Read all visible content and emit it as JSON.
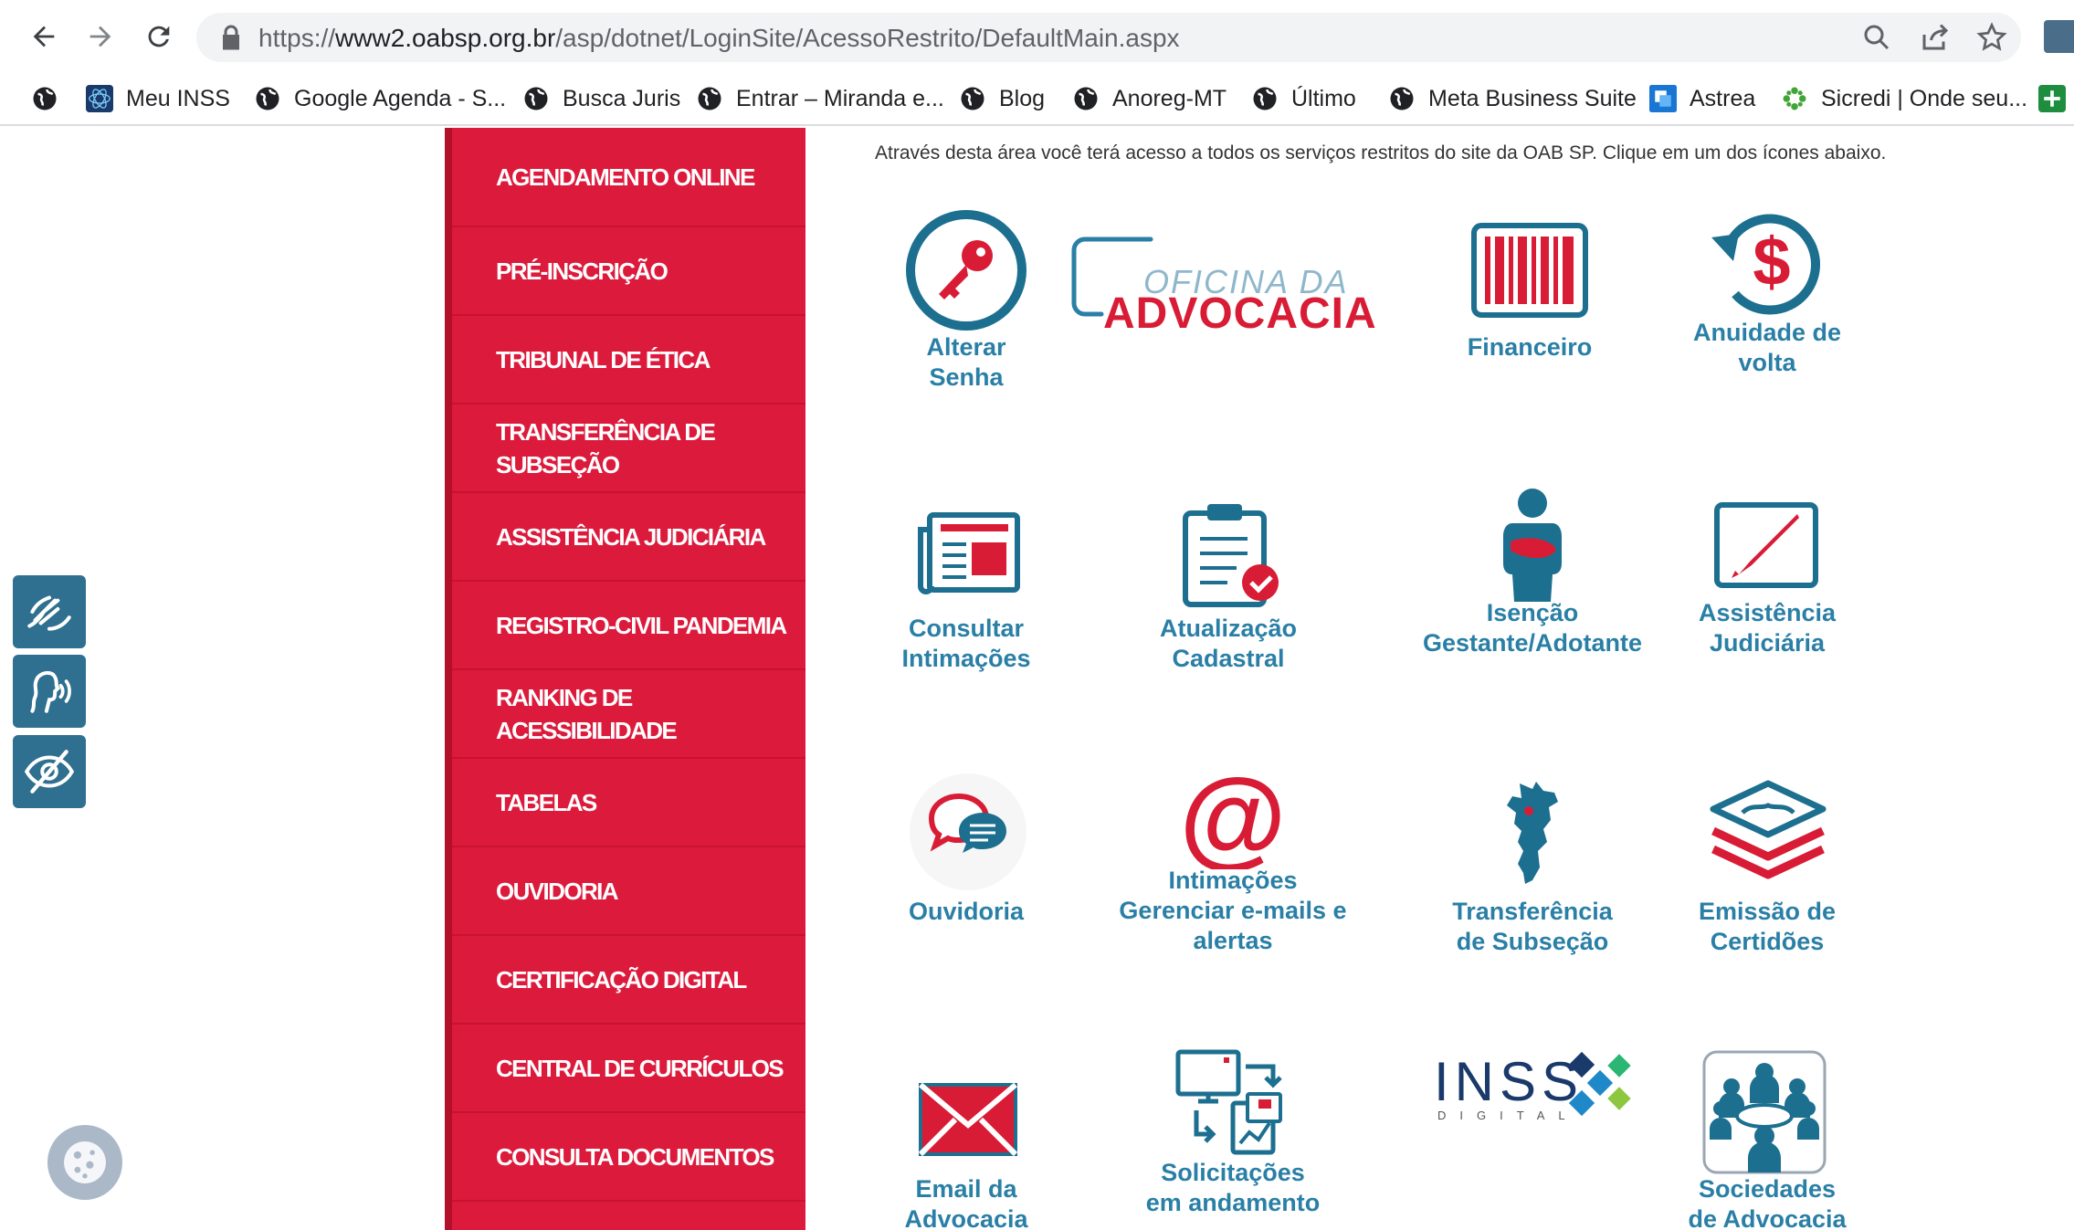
{
  "browser": {
    "url_prefix": "https://",
    "url_host": "www2.oabsp.org.br",
    "url_path": "/asp/dotnet/LoginSite/AcessoRestrito/DefaultMain.aspx"
  },
  "bookmarks": [
    {
      "label": "Meu INSS"
    },
    {
      "label": "Google Agenda - S..."
    },
    {
      "label": "Busca Juris"
    },
    {
      "label": "Entrar – Miranda e..."
    },
    {
      "label": "Blog"
    },
    {
      "label": "Anoreg-MT"
    },
    {
      "label": "Último"
    },
    {
      "label": "Meta Business Suite"
    },
    {
      "label": "Astrea"
    },
    {
      "label": "Sicredi | Onde seu..."
    }
  ],
  "sidebar": {
    "items": [
      {
        "label": "AGENDAMENTO ONLINE"
      },
      {
        "label": "PRÉ-INSCRIÇÃO"
      },
      {
        "label": "TRIBUNAL DE ÉTICA"
      },
      {
        "label": "TRANSFERÊNCIA DE",
        "label2": "SUBSEÇÃO"
      },
      {
        "label": "ASSISTÊNCIA JUDICIÁRIA"
      },
      {
        "label": "REGISTRO-CIVIL PANDEMIA"
      },
      {
        "label": "RANKING DE",
        "label2": "ACESSIBILIDADE"
      },
      {
        "label": "TABELAS"
      },
      {
        "label": "OUVIDORIA"
      },
      {
        "label": "CERTIFICAÇÃO DIGITAL"
      },
      {
        "label": "CENTRAL DE CURRÍCULOS"
      },
      {
        "label": "CONSULTA DOCUMENTOS"
      }
    ]
  },
  "main": {
    "intro": "Através desta área você terá acesso a todos os serviços restritos do site da OAB SP. Clique em um dos ícones abaixo.",
    "oficina_logo": {
      "line1": "OFICINA DA",
      "line2": "ADVOCACIA"
    },
    "inss_logo": {
      "line1": "INSS",
      "line2": "DIGITAL"
    },
    "tiles": [
      {
        "line1": "Alterar",
        "line2": "Senha",
        "icon": "key-icon"
      },
      {
        "line1": "Financeiro",
        "icon": "barcode-icon"
      },
      {
        "line1": "Anuidade de",
        "line2": "volta",
        "icon": "dollar-refresh-icon"
      },
      {
        "line1": "Consultar",
        "line2": "Intimações",
        "icon": "newspaper-icon"
      },
      {
        "line1": "Atualização",
        "line2": "Cadastral",
        "icon": "clipboard-check-icon"
      },
      {
        "line1": "Isenção",
        "line2": "Gestante/Adotante",
        "icon": "pregnant-woman-icon"
      },
      {
        "line1": "Assistência",
        "line2": "Judiciária",
        "icon": "pen-icon"
      },
      {
        "line1": "Ouvidoria",
        "icon": "chat-bubbles-icon"
      },
      {
        "line1": "Intimações",
        "line2": "Gerenciar e-mails e",
        "line3": "alertas",
        "icon": "at-sign-icon"
      },
      {
        "line1": "Transferência",
        "line2": "de Subseção",
        "icon": "sao-paulo-map-icon"
      },
      {
        "line1": "Emissão de",
        "line2": "Certidões",
        "icon": "layers-icon"
      },
      {
        "line1": "Email da",
        "line2": "Advocacia",
        "icon": "envelope-icon"
      },
      {
        "line1": "Solicitações",
        "line2": "em andamento",
        "icon": "computer-documents-icon"
      },
      {
        "line1": "Sociedades",
        "line2": "de Advocacia",
        "icon": "meeting-people-icon"
      }
    ]
  },
  "colors": {
    "sidebar_red": "#dc1a3c",
    "link_blue": "#2a7fa6",
    "icon_teal": "#1d6f8f",
    "icon_red": "#d91c35"
  }
}
